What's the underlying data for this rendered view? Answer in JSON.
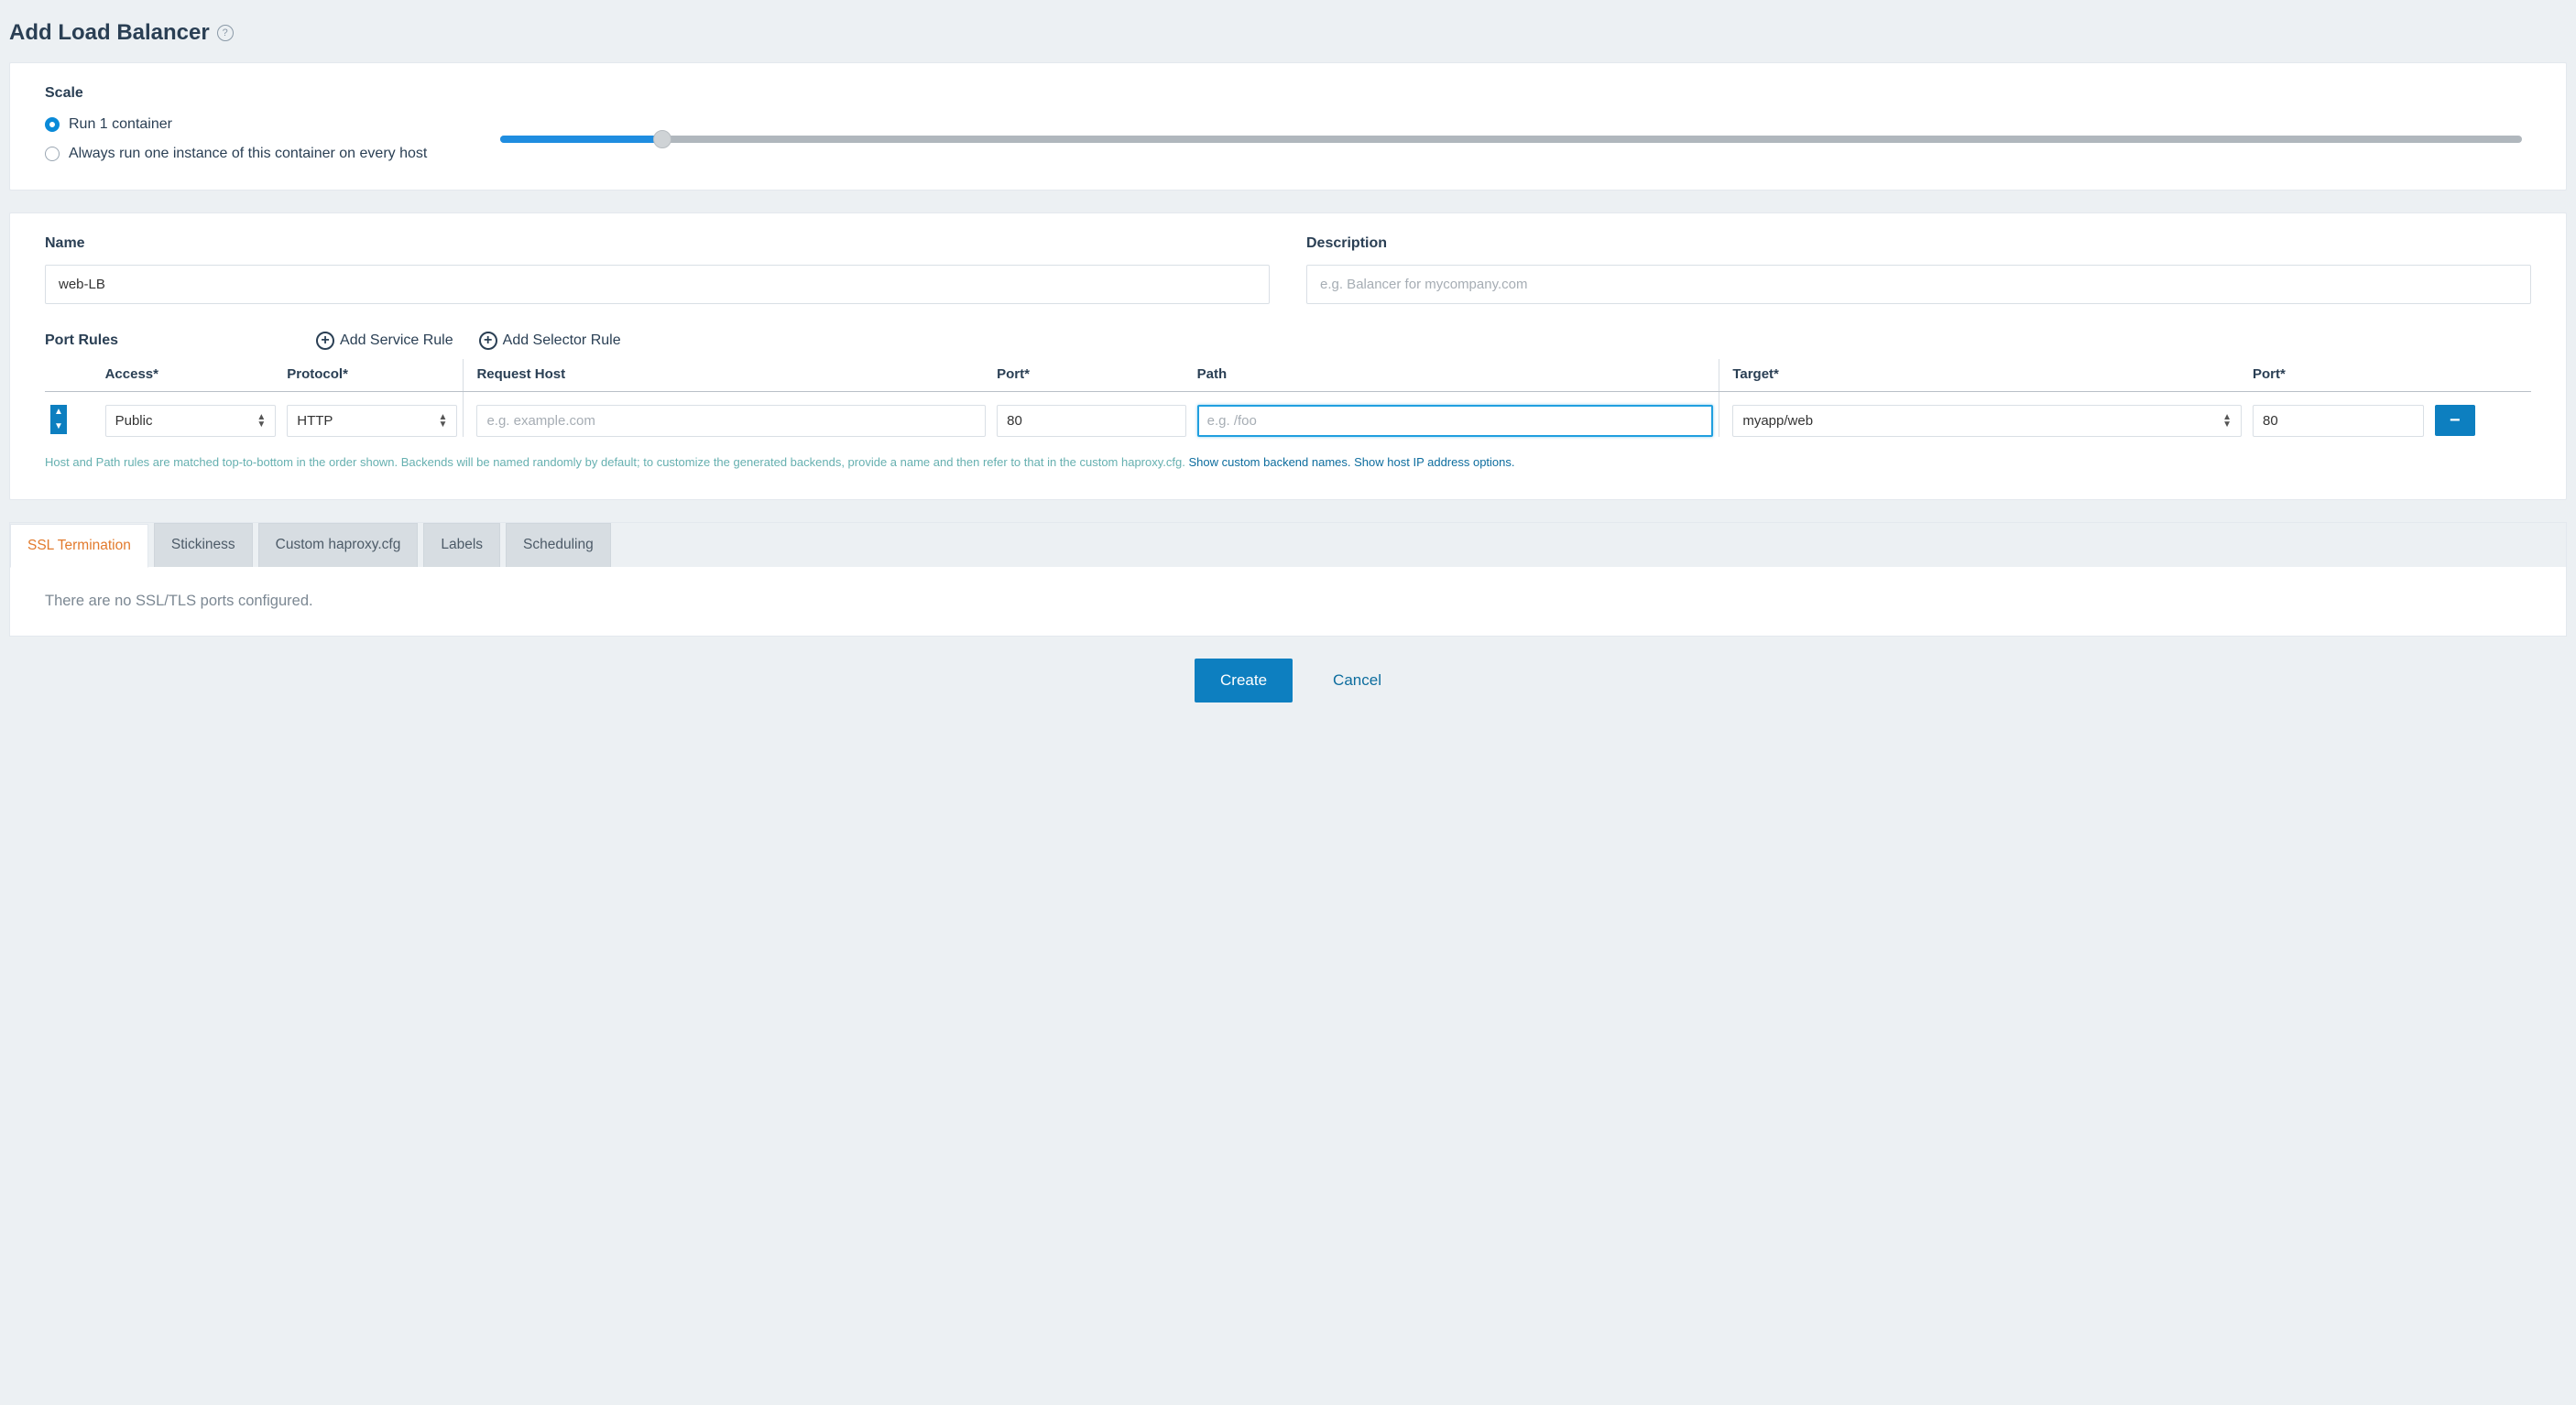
{
  "page": {
    "title": "Add Load Balancer"
  },
  "scale": {
    "heading": "Scale",
    "option_run_n": "Run 1 container",
    "option_every_host": "Always run one instance of this container on every host"
  },
  "name_desc": {
    "name_label": "Name",
    "name_value": "web-LB",
    "desc_label": "Description",
    "desc_placeholder": "e.g. Balancer for mycompany.com"
  },
  "port_rules": {
    "heading": "Port Rules",
    "add_service": "Add Service Rule",
    "add_selector": "Add Selector Rule",
    "col_access": "Access*",
    "col_protocol": "Protocol*",
    "col_request_host": "Request Host",
    "col_port_a": "Port*",
    "col_path": "Path",
    "col_target": "Target*",
    "col_port_b": "Port*",
    "row": {
      "access": "Public",
      "protocol": "HTTP",
      "request_host_placeholder": "e.g. example.com",
      "port_a": "80",
      "path_placeholder": "e.g. /foo",
      "target": "myapp/web",
      "port_b": "80"
    },
    "hint_plain": "Host and Path rules are matched top-to-bottom in the order shown. Backends will be named randomly by default; to customize the generated backends, provide a name and then refer to that in the custom haproxy.cfg. ",
    "hint_link1": "Show custom backend names.",
    "hint_link2": "Show host IP address options."
  },
  "tabs": {
    "ssl": "SSL Termination",
    "stickiness": "Stickiness",
    "haproxy": "Custom haproxy.cfg",
    "labels": "Labels",
    "scheduling": "Scheduling",
    "ssl_empty": "There are no SSL/TLS ports configured."
  },
  "footer": {
    "create": "Create",
    "cancel": "Cancel"
  }
}
